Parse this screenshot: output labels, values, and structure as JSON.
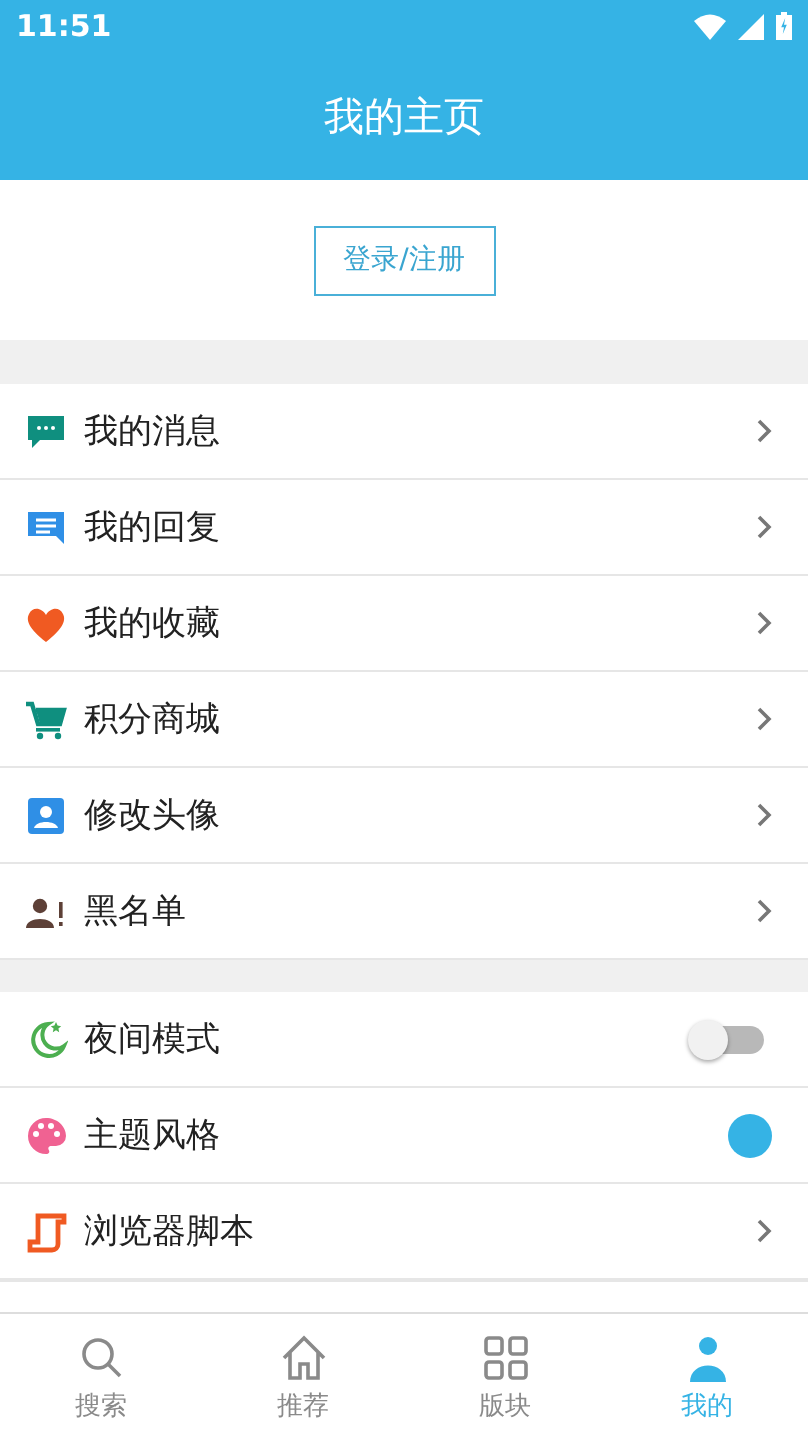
{
  "status_bar": {
    "time": "11:51"
  },
  "header": {
    "title": "我的主页"
  },
  "login_button": {
    "label": "登录/注册"
  },
  "groups": [
    {
      "items": [
        {
          "kind": "link",
          "label": "我的消息"
        },
        {
          "kind": "link",
          "label": "我的回复"
        },
        {
          "kind": "link",
          "label": "我的收藏"
        },
        {
          "kind": "link",
          "label": "积分商城"
        },
        {
          "kind": "link",
          "label": "修改头像"
        },
        {
          "kind": "link",
          "label": "黑名单"
        }
      ]
    },
    {
      "items": [
        {
          "kind": "toggle",
          "label": "夜间模式",
          "on": false
        },
        {
          "kind": "color",
          "label": "主题风格",
          "color": "#35b3e5"
        },
        {
          "kind": "link",
          "label": "浏览器脚本"
        }
      ]
    }
  ],
  "bottom_nav": [
    {
      "label": "搜索",
      "selected": false
    },
    {
      "label": "推荐",
      "selected": false
    },
    {
      "label": "版块",
      "selected": false
    },
    {
      "label": "我的",
      "selected": true
    }
  ]
}
